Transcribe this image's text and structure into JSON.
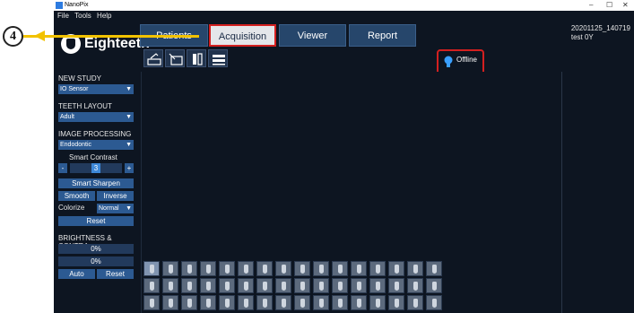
{
  "window": {
    "title": "NanoPix",
    "controls": [
      "–",
      "☐",
      "✕"
    ]
  },
  "menu": [
    "File",
    "Tools",
    "Help"
  ],
  "logo": {
    "text": "Eighteeth"
  },
  "tabs": [
    {
      "label": "Patients",
      "active": false
    },
    {
      "label": "Acquisition",
      "active": true
    },
    {
      "label": "Viewer",
      "active": false
    },
    {
      "label": "Report",
      "active": false
    }
  ],
  "datetime": {
    "stamp": "20201125_140719",
    "patient": "test  0Y"
  },
  "toolbar": [
    "acquire-icon",
    "import-icon",
    "split-icon",
    "list-icon"
  ],
  "status": {
    "text": "Offline",
    "icon": "lightbulb-icon"
  },
  "sidebar": {
    "new_study": {
      "label": "NEW STUDY",
      "value": "IO Sensor"
    },
    "teeth_layout": {
      "label": "TEETH LAYOUT",
      "value": "Adult"
    },
    "image_processing": {
      "label": "IMAGE PROCESSING",
      "value": "Endodontic"
    },
    "smart_contrast": {
      "label": "Smart Contrast",
      "minus": "-",
      "value": "3",
      "plus": "+"
    },
    "smart_sharpen": "Smart Sharpen",
    "smooth": "Smooth",
    "inverse": "Inverse",
    "colorize": {
      "label": "Colorize",
      "value": "Normal"
    },
    "reset": "Reset",
    "brightness": {
      "label": "BRIGHTNESS & CONTRA",
      "brightness_value": "0%",
      "contrast_value": "0%"
    },
    "auto": "Auto",
    "reset2": "Reset"
  },
  "annotation": {
    "number": "4"
  },
  "colors": {
    "background": "#0d1521",
    "accent": "#2c5a92",
    "tab": "#26466b",
    "highlight": "#d32020",
    "arrow": "#f2c200"
  }
}
